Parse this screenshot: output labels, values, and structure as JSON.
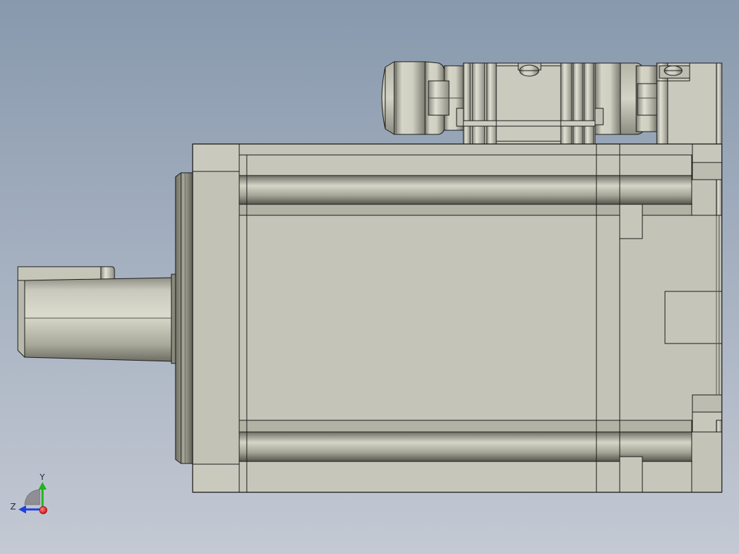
{
  "viewport": {
    "background_top": "#8899ad",
    "background_bottom": "#c4c9d3"
  },
  "model": {
    "part": "servo-motor",
    "view": "side-orthographic",
    "body_color": "#c3c3b7",
    "edge_color": "#1a1a1a",
    "components": [
      "shaft",
      "keyway",
      "mounting-flange",
      "pilot-boss",
      "motor-housing",
      "rear-end-cap",
      "power-connector",
      "encoder-connector"
    ]
  },
  "triad": {
    "y_label": "Y",
    "z_label": "Z",
    "y_color": "#1fb31f",
    "z_color": "#1f3fe0",
    "x_color": "#e01b1b"
  }
}
